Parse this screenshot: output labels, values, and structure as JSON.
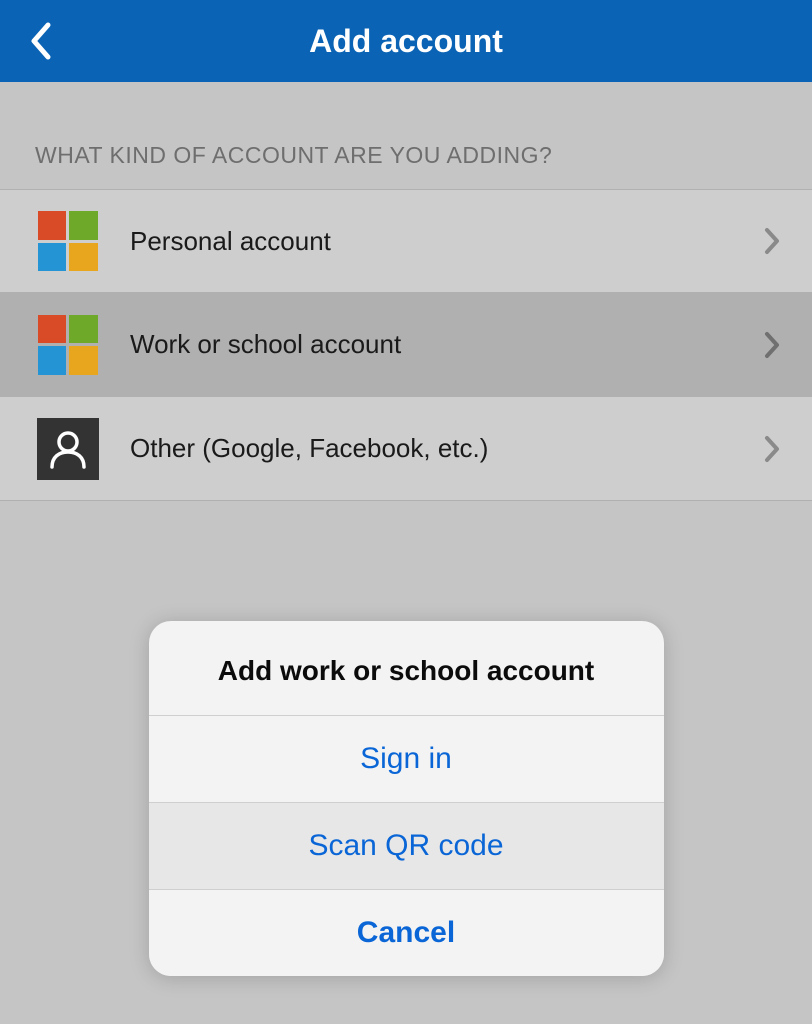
{
  "header": {
    "title": "Add account"
  },
  "section_title": "WHAT KIND OF ACCOUNT ARE YOU ADDING?",
  "rows": {
    "personal": "Personal account",
    "work": "Work or school account",
    "other": "Other (Google, Facebook, etc.)"
  },
  "sheet": {
    "title": "Add work or school account",
    "signin": "Sign in",
    "scanqr": "Scan QR code",
    "cancel": "Cancel"
  }
}
